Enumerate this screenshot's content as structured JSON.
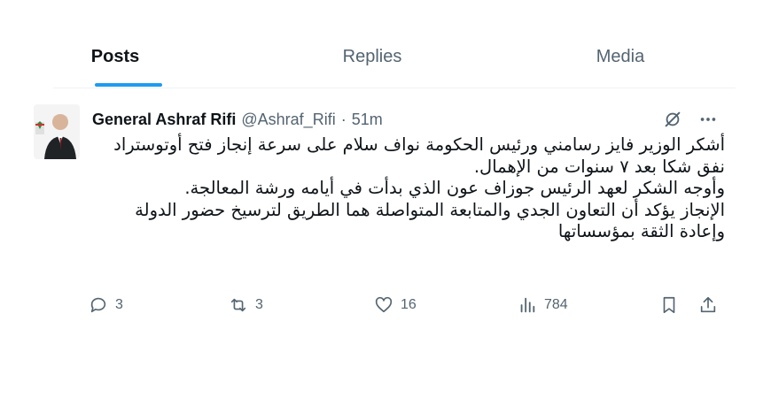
{
  "tabs": [
    {
      "label": "Posts",
      "active": true
    },
    {
      "label": "Replies",
      "active": false
    },
    {
      "label": "Media",
      "active": false
    }
  ],
  "post": {
    "author_name": "General Ashraf Rifi",
    "handle": "@Ashraf_Rifi",
    "separator": "·",
    "time": "51m",
    "text_lines": [
      "أشكر الوزير فايز رسامني ورئيس الحكومة نواف سلام على سرعة إنجاز فتح أوتوستراد",
      "نفق شكا بعد ٧ سنوات من الإهمال.",
      "وأوجه الشكر لعهد الرئيس جوزاف عون الذي بدأت في أيامه ورشة المعالجة.",
      "الإنجاز يؤكد أن التعاون الجدي والمتابعة المتواصلة هما الطريق لترسيخ حضور الدولة",
      "وإعادة الثقة بمؤسساتها"
    ],
    "actions": {
      "replies": "3",
      "reposts": "3",
      "likes": "16",
      "views": "784"
    }
  },
  "icons": [
    "grok-icon",
    "more-icon",
    "reply-icon",
    "repost-icon",
    "like-icon",
    "views-icon",
    "bookmark-icon",
    "share-icon"
  ],
  "colors": {
    "accent": "#1d9bf0",
    "muted": "#536471",
    "text": "#0f1419"
  }
}
